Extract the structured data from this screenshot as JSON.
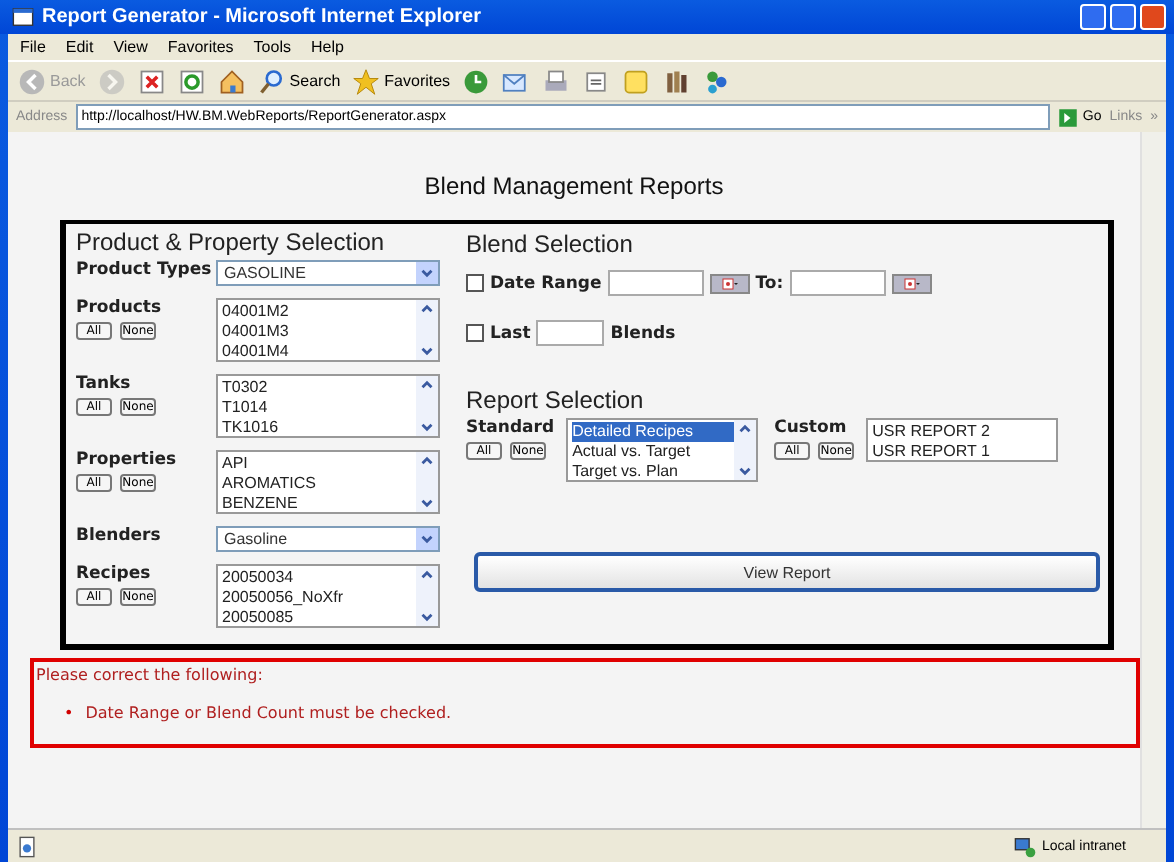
{
  "window": {
    "title": "Report Generator - Microsoft Internet Explorer"
  },
  "menu": [
    "File",
    "Edit",
    "View",
    "Favorites",
    "Tools",
    "Help"
  ],
  "toolbar": [
    {
      "kind": "back",
      "label": "Back",
      "disabled": true
    },
    {
      "kind": "forward",
      "disabled": true
    },
    {
      "kind": "stop"
    },
    {
      "kind": "refresh"
    },
    {
      "kind": "home"
    },
    {
      "kind": "search",
      "label": "Search"
    },
    {
      "kind": "favorites",
      "label": "Favorites"
    },
    {
      "kind": "history"
    },
    {
      "kind": "mail"
    },
    {
      "kind": "print"
    },
    {
      "kind": "edit"
    },
    {
      "kind": "note"
    },
    {
      "kind": "research"
    },
    {
      "kind": "messenger"
    }
  ],
  "address": {
    "label": "Address",
    "url": "http://localhost/HW.BM.WebReports/ReportGenerator.aspx",
    "go": "Go",
    "links": "Links",
    "more": "»"
  },
  "heading": "Blend Management Reports",
  "product_selection": {
    "title": "Product & Property Selection",
    "rows": [
      {
        "kind": "dropdown",
        "label": "Product Types",
        "value": "GASOLINE"
      },
      {
        "kind": "list",
        "label": "Products",
        "buttons": [
          "All",
          "None"
        ],
        "items": [
          "04001M2",
          "04001M3",
          "04001M4"
        ]
      },
      {
        "kind": "list",
        "label": "Tanks",
        "buttons": [
          "All",
          "None"
        ],
        "items": [
          "T0302",
          "T1014",
          "TK1016"
        ]
      },
      {
        "kind": "list",
        "label": "Properties",
        "buttons": [
          "All",
          "None"
        ],
        "items": [
          "API",
          "AROMATICS",
          "BENZENE"
        ]
      },
      {
        "kind": "dropdown",
        "label": "Blenders",
        "value": "Gasoline"
      },
      {
        "kind": "list",
        "label": "Recipes",
        "buttons": [
          "All",
          "None"
        ],
        "items": [
          "20050034",
          "20050056_NoXfr",
          "20050085"
        ]
      }
    ]
  },
  "blend_selection": {
    "title": "Blend Selection",
    "date_range": {
      "label": "Date Range",
      "checked": false,
      "to_label": "To:"
    },
    "last": {
      "label": "Last",
      "checked": false,
      "suffix": "Blends"
    }
  },
  "report_selection": {
    "title": "Report Selection",
    "groups": [
      {
        "kind": "scrolling",
        "label": "Standard",
        "buttons": [
          "All",
          "None"
        ],
        "items": [
          {
            "text": "Detailed Recipes",
            "selected": true
          },
          {
            "text": "Actual vs. Target",
            "selected": false
          },
          {
            "text": "Target vs. Plan",
            "selected": false
          }
        ]
      },
      {
        "kind": "plain",
        "label": "Custom",
        "buttons": [
          "All",
          "None"
        ],
        "items": [
          {
            "text": "USR REPORT 2",
            "selected": false
          },
          {
            "text": "USR REPORT 1",
            "selected": false
          }
        ]
      }
    ]
  },
  "view_report": "View Report",
  "errors": {
    "heading": "Please correct the following:",
    "items": [
      {
        "bullet": "•",
        "text": "Date Range or Blend Count must be checked."
      }
    ]
  },
  "status_bar": {
    "zone": "Local intranet"
  }
}
